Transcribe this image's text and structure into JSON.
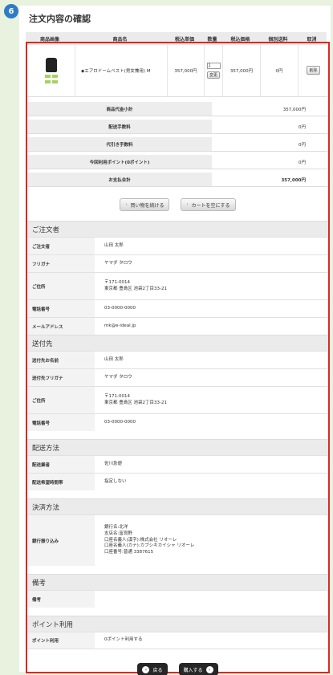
{
  "step": "6",
  "page_title": "注文内容の確認",
  "columns": [
    "商品画像",
    "商品名",
    "税込単価",
    "数量",
    "税込価格",
    "個別送料",
    "取消"
  ],
  "product": {
    "name": "◆エアロドームベスト(男女兼用) M",
    "unit_price": "357,000円",
    "quantity": "1",
    "change_label": "変更",
    "price": "357,000円",
    "shipping": "0円",
    "delete_label": "削除"
  },
  "summary": [
    {
      "label": "商品代金小計",
      "value": "357,000円"
    },
    {
      "label": "配送手数料",
      "value": "0円"
    },
    {
      "label": "代引き手数料",
      "value": "0円"
    },
    {
      "label": "今回利用ポイント(0ポイント)",
      "value": "0円"
    },
    {
      "label": "お支払合計",
      "value": "357,000円"
    }
  ],
  "buttons": {
    "continue_shopping": "買い物を続ける",
    "empty_cart": "カートを空にする",
    "back": "戻る",
    "purchase": "購入する"
  },
  "orderer": {
    "title": "ご注文者",
    "rows": [
      {
        "label": "ご注文者",
        "value": "山田 太郎"
      },
      {
        "label": "フリガナ",
        "value": "ヤマダ タロウ"
      },
      {
        "label": "ご住所",
        "line1": "〒171-0014",
        "line2": "東京都 豊島区 池袋2丁目33-21"
      },
      {
        "label": "電話番号",
        "value": "03-0000-0000"
      },
      {
        "label": "メールアドレス",
        "value": "mk@e-ideal.jp"
      }
    ]
  },
  "shipping_to": {
    "title": "送付先",
    "rows": [
      {
        "label": "送付先お名前",
        "value": "山田 太郎"
      },
      {
        "label": "送付先フリガナ",
        "value": "ヤマダ タロウ"
      },
      {
        "label": "ご住所",
        "line1": "〒171-0014",
        "line2": "東京都 豊島区 池袋2丁目33-21"
      },
      {
        "label": "電話番号",
        "value": "03-0000-0000"
      }
    ]
  },
  "delivery": {
    "title": "配送方法",
    "rows": [
      {
        "label": "配送業者",
        "value": "佐川急便"
      },
      {
        "label": "配送希望時間帯",
        "value": "指定しない"
      }
    ]
  },
  "payment": {
    "title": "決済方法",
    "label": "銀行振り込み",
    "lines": [
      "銀行名:北洋",
      "支店名:富良野",
      "口座名義人(漢字):株式会社 リオーレ",
      "口座名義人(カナ):カブシキカイシャ リオーレ",
      "口座番号:普通 3387615"
    ]
  },
  "remarks": {
    "title": "備考",
    "label": "備考",
    "value": ""
  },
  "points": {
    "title": "ポイント利用",
    "label": "ポイント利用",
    "value": "0ポイント利用する"
  },
  "colors": {
    "accent_red": "#e0261c",
    "badge_blue": "#2f7bc6",
    "bg_green": "#e9f2df"
  }
}
